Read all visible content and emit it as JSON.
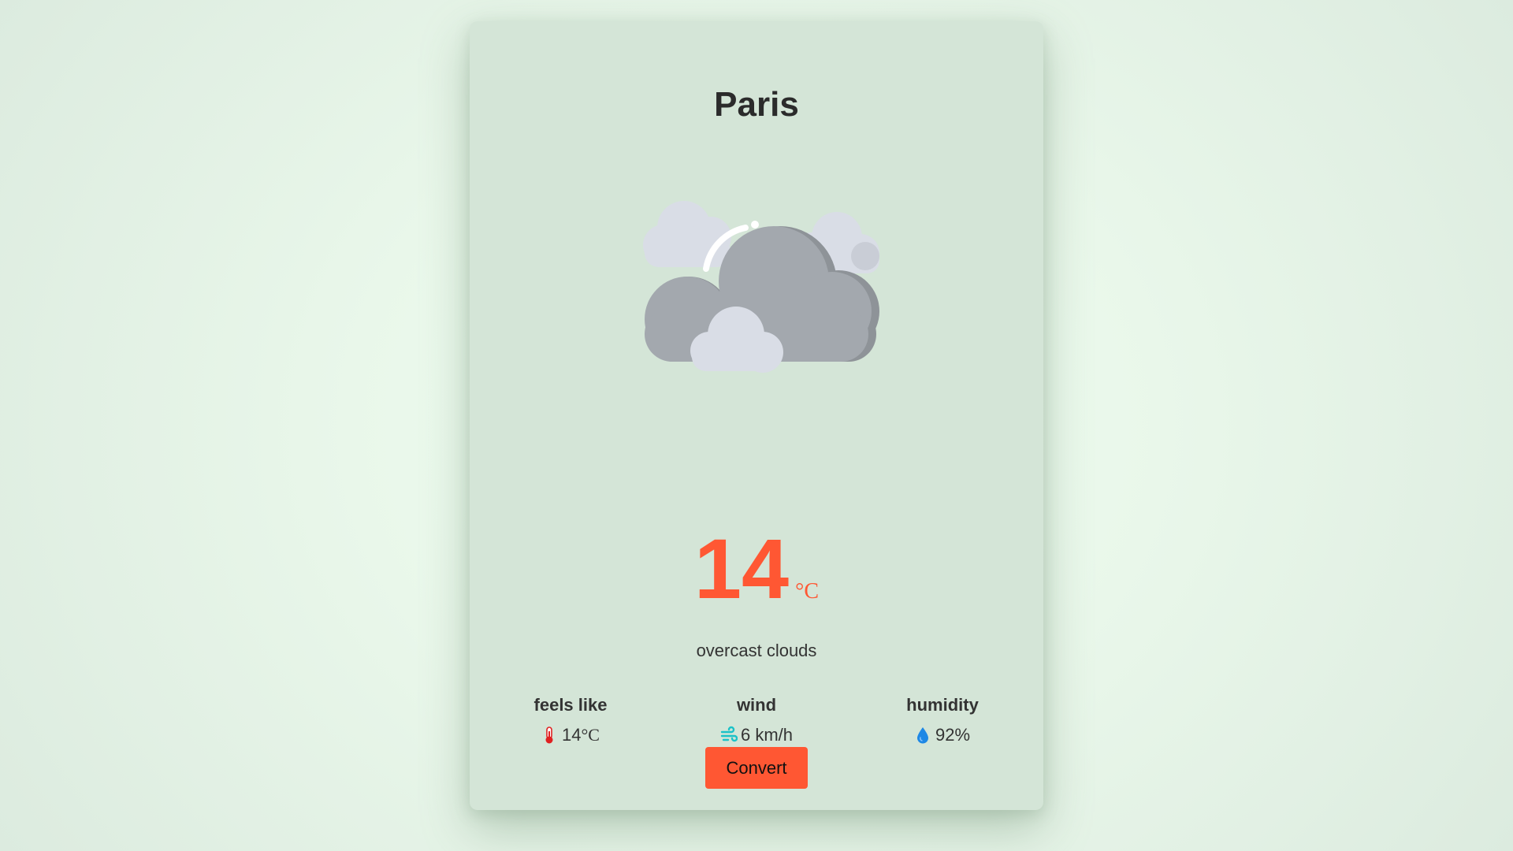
{
  "city": "Paris",
  "weather": {
    "icon": "overcast-clouds-icon",
    "temperature": "14",
    "temperature_unit": "°C",
    "description": "overcast clouds"
  },
  "stats": {
    "feels_like": {
      "label": "feels like",
      "icon": "thermometer-icon",
      "value": "14",
      "unit": "°C"
    },
    "wind": {
      "label": "wind",
      "icon": "wind-icon",
      "value": "6 km/h"
    },
    "humidity": {
      "label": "humidity",
      "icon": "water-drop-icon",
      "value": "92%"
    }
  },
  "actions": {
    "convert_label": "Convert"
  },
  "colors": {
    "accent": "#ff5733",
    "card_background": "#d4e5d7",
    "page_background": "#e9f7ea",
    "text": "#333333"
  }
}
